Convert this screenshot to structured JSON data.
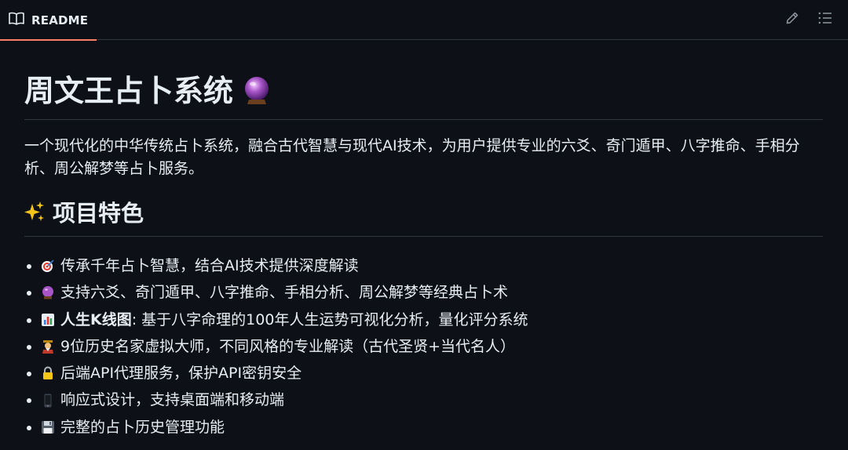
{
  "header": {
    "tab_label": "README",
    "tab_icon": "book-icon",
    "actions": [
      "edit-icon",
      "outline-list-icon"
    ],
    "accent_color": "#f78166"
  },
  "readme": {
    "title": "周文王占卜系统",
    "intro": "一个现代化的中华传统占卜系统，融合古代智慧与现代AI技术，为用户提供专业的六爻、奇门遁甲、八字推命、手相分析、周公解梦等占卜服务。",
    "features_heading": "项目特色",
    "features": [
      {
        "icon": "target-icon",
        "text": "传承千年占卜智慧，结合AI技术提供深度解读"
      },
      {
        "icon": "crystal-ball-icon",
        "text": "支持六爻、奇门遁甲、八字推命、手相分析、周公解梦等经典占卜术"
      },
      {
        "icon": "bar-chart-icon",
        "bold": "人生K线图",
        "text": ": 基于八字命理的100年人生运势可视化分析，量化评分系统"
      },
      {
        "icon": "scholar-icon",
        "text": "9位历史名家虚拟大师，不同风格的专业解读（古代圣贤+当代名人）"
      },
      {
        "icon": "lock-icon",
        "text": "后端API代理服务，保护API密钥安全"
      },
      {
        "icon": "mobile-phone-icon",
        "text": "响应式设计，支持桌面端和移动端"
      },
      {
        "icon": "floppy-disk-icon",
        "text": "完整的占卜历史管理功能"
      }
    ]
  }
}
